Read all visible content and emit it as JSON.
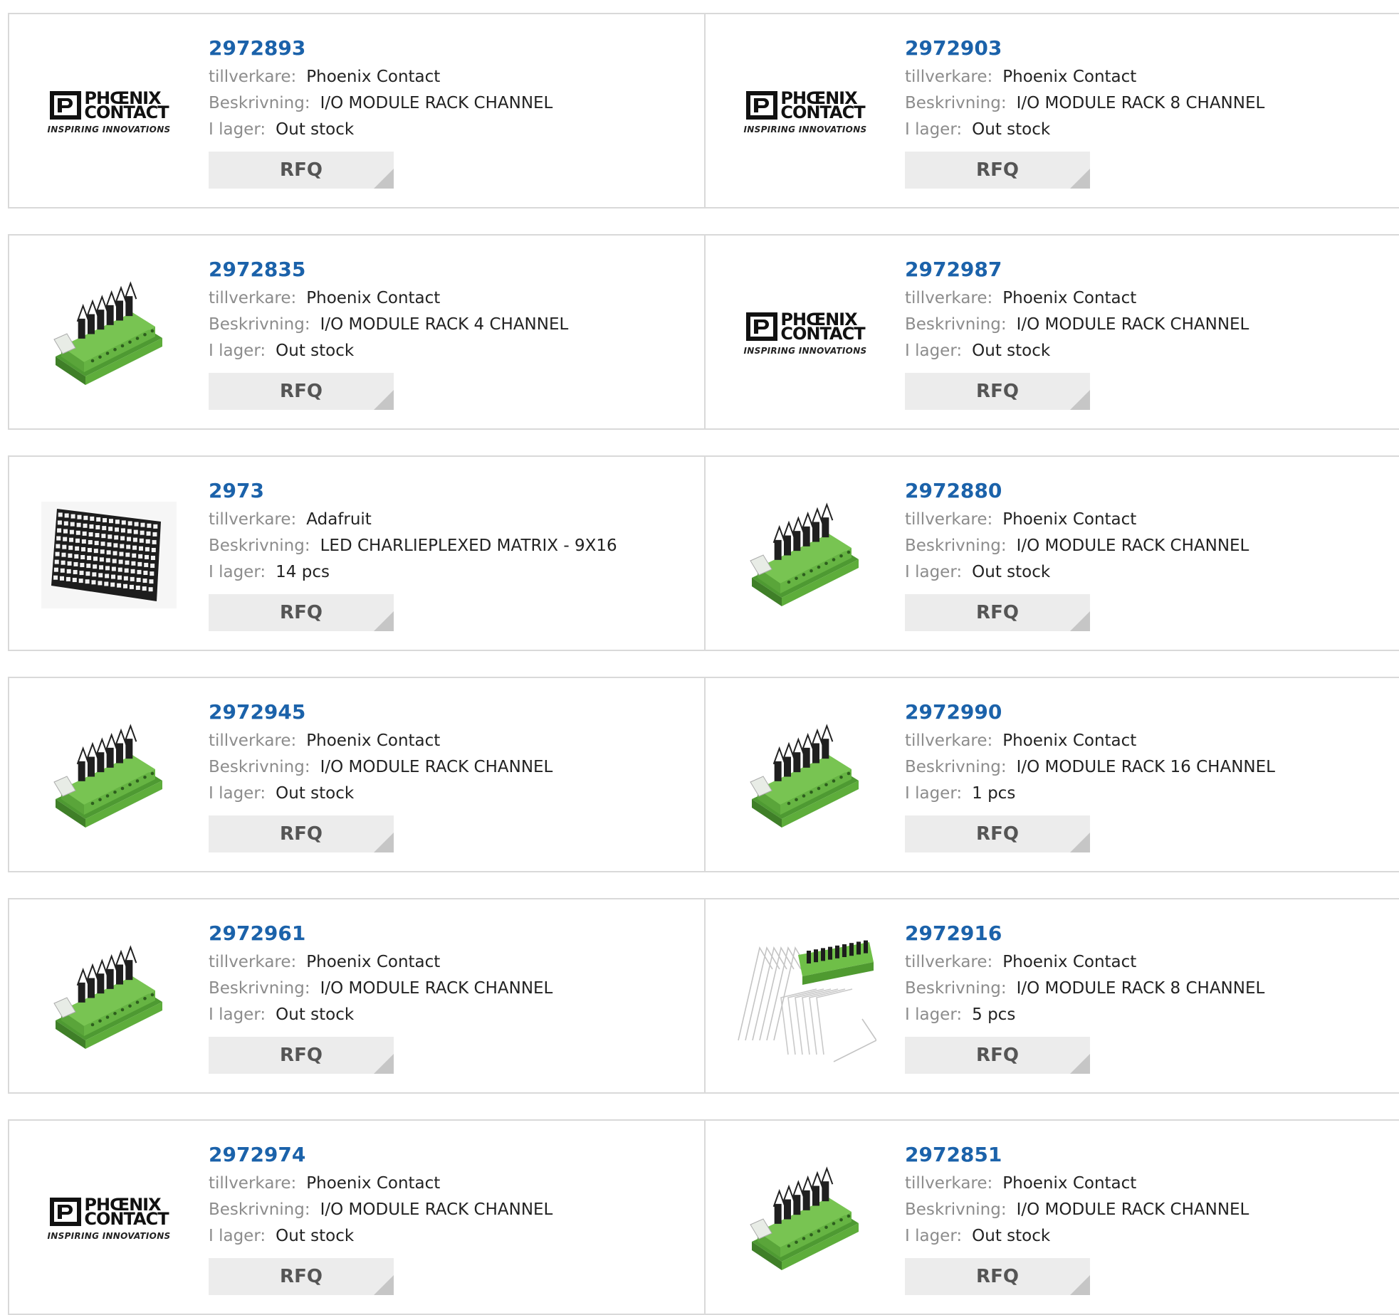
{
  "labels": {
    "manufacturer": "tillverkare:",
    "description": "Beskrivning:",
    "stock": "I lager:",
    "rfq": "RFQ"
  },
  "colors": {
    "part_link": "#1b62aa",
    "label": "#8c8c8c",
    "value": "#222222",
    "rfq_bg": "#ececec",
    "border": "#d9d9d9",
    "module_green": "#6fbf48"
  },
  "logo": {
    "line1": "PHŒNIX",
    "line2": "CONTACT",
    "tagline": "INSPIRING INNOVATIONS"
  },
  "products": [
    {
      "part": "2972893",
      "manufacturer": "Phoenix Contact",
      "description": "I/O MODULE RACK CHANNEL",
      "stock": "Out stock",
      "image": "phoenix-contact-logo"
    },
    {
      "part": "2972903",
      "manufacturer": "Phoenix Contact",
      "description": "I/O MODULE RACK 8 CHANNEL",
      "stock": "Out stock",
      "image": "phoenix-contact-logo"
    },
    {
      "part": "2972835",
      "manufacturer": "Phoenix Contact",
      "description": "I/O MODULE RACK 4 CHANNEL",
      "stock": "Out stock",
      "image": "io-module-photo"
    },
    {
      "part": "2972987",
      "manufacturer": "Phoenix Contact",
      "description": "I/O MODULE RACK CHANNEL",
      "stock": "Out stock",
      "image": "phoenix-contact-logo"
    },
    {
      "part": "2973",
      "manufacturer": "Adafruit",
      "description": "LED CHARLIEPLEXED MATRIX - 9X16",
      "stock": "14 pcs",
      "image": "led-matrix-photo"
    },
    {
      "part": "2972880",
      "manufacturer": "Phoenix Contact",
      "description": "I/O MODULE RACK CHANNEL",
      "stock": "Out stock",
      "image": "io-module-photo"
    },
    {
      "part": "2972945",
      "manufacturer": "Phoenix Contact",
      "description": "I/O MODULE RACK CHANNEL",
      "stock": "Out stock",
      "image": "io-module-photo"
    },
    {
      "part": "2972990",
      "manufacturer": "Phoenix Contact",
      "description": "I/O MODULE RACK 16 CHANNEL",
      "stock": "1 pcs",
      "image": "io-module-photo"
    },
    {
      "part": "2972961",
      "manufacturer": "Phoenix Contact",
      "description": "I/O MODULE RACK CHANNEL",
      "stock": "Out stock",
      "image": "io-module-photo"
    },
    {
      "part": "2972916",
      "manufacturer": "Phoenix Contact",
      "description": "I/O MODULE RACK 8 CHANNEL",
      "stock": "5 pcs",
      "image": "module-with-brackets-photo"
    },
    {
      "part": "2972974",
      "manufacturer": "Phoenix Contact",
      "description": "I/O MODULE RACK CHANNEL",
      "stock": "Out stock",
      "image": "phoenix-contact-logo"
    },
    {
      "part": "2972851",
      "manufacturer": "Phoenix Contact",
      "description": "I/O MODULE RACK CHANNEL",
      "stock": "Out stock",
      "image": "io-module-photo"
    }
  ]
}
